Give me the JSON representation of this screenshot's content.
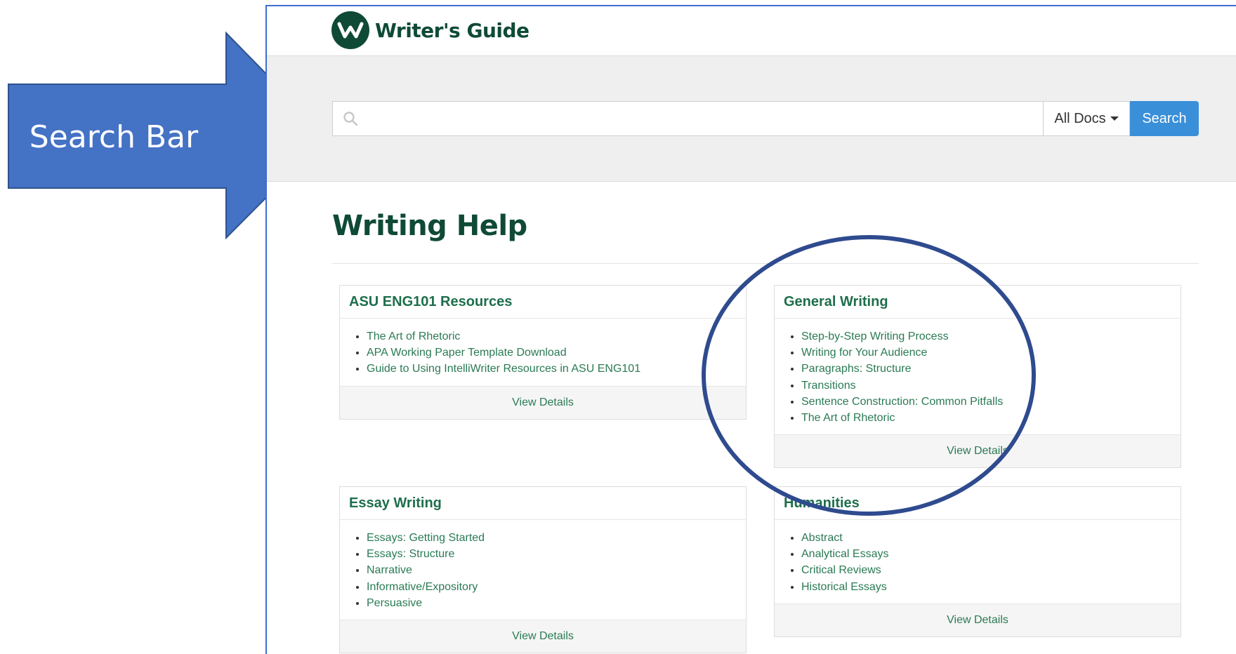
{
  "callout": {
    "label": "Search Bar",
    "color": "#4472c4"
  },
  "header": {
    "logo_text": "Writer's Guide"
  },
  "search": {
    "placeholder": "",
    "value": "",
    "scope_selected": "All Docs",
    "button_label": "Search"
  },
  "main": {
    "title": "Writing Help",
    "cards": [
      {
        "title": "ASU ENG101 Resources",
        "items": [
          "The Art of Rhetoric",
          "APA Working Paper Template Download",
          "Guide to Using IntelliWriter Resources in ASU ENG101"
        ],
        "footer": "View Details"
      },
      {
        "title": "General Writing",
        "items": [
          "Step-by-Step Writing Process",
          "Writing for Your Audience",
          "Paragraphs: Structure",
          "Transitions",
          "Sentence Construction: Common Pitfalls",
          "The Art of Rhetoric"
        ],
        "footer": "View Details"
      },
      {
        "title": "Essay Writing",
        "items": [
          "Essays: Getting Started",
          "Essays: Structure",
          "Narrative",
          "Informative/Expository",
          "Persuasive"
        ],
        "footer": "View Details"
      },
      {
        "title": "Humanities",
        "items": [
          "Abstract",
          "Analytical Essays",
          "Critical Reviews",
          "Historical Essays"
        ],
        "footer": "View Details"
      }
    ]
  },
  "colors": {
    "brand": "#0f4a37",
    "link": "#2a7a55",
    "search_button": "#3a8fd9",
    "annotation": "#2f4b8f"
  },
  "annotation": {
    "shape": "ellipse-highlight"
  }
}
